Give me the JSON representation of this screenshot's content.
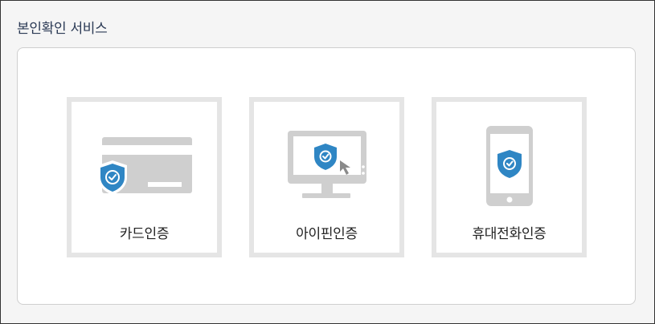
{
  "page": {
    "title": "본인확인 서비스"
  },
  "methods": [
    {
      "label": "카드인증",
      "icon": "credit-card-shield-icon"
    },
    {
      "label": "아이핀인증",
      "icon": "monitor-shield-cursor-icon"
    },
    {
      "label": "휴대전화인증",
      "icon": "smartphone-shield-icon"
    }
  ],
  "colors": {
    "shield": "#2f86c4",
    "device_gray": "#cfcfcf",
    "card_border": "#e5e5e5",
    "title": "#2b3a55"
  }
}
